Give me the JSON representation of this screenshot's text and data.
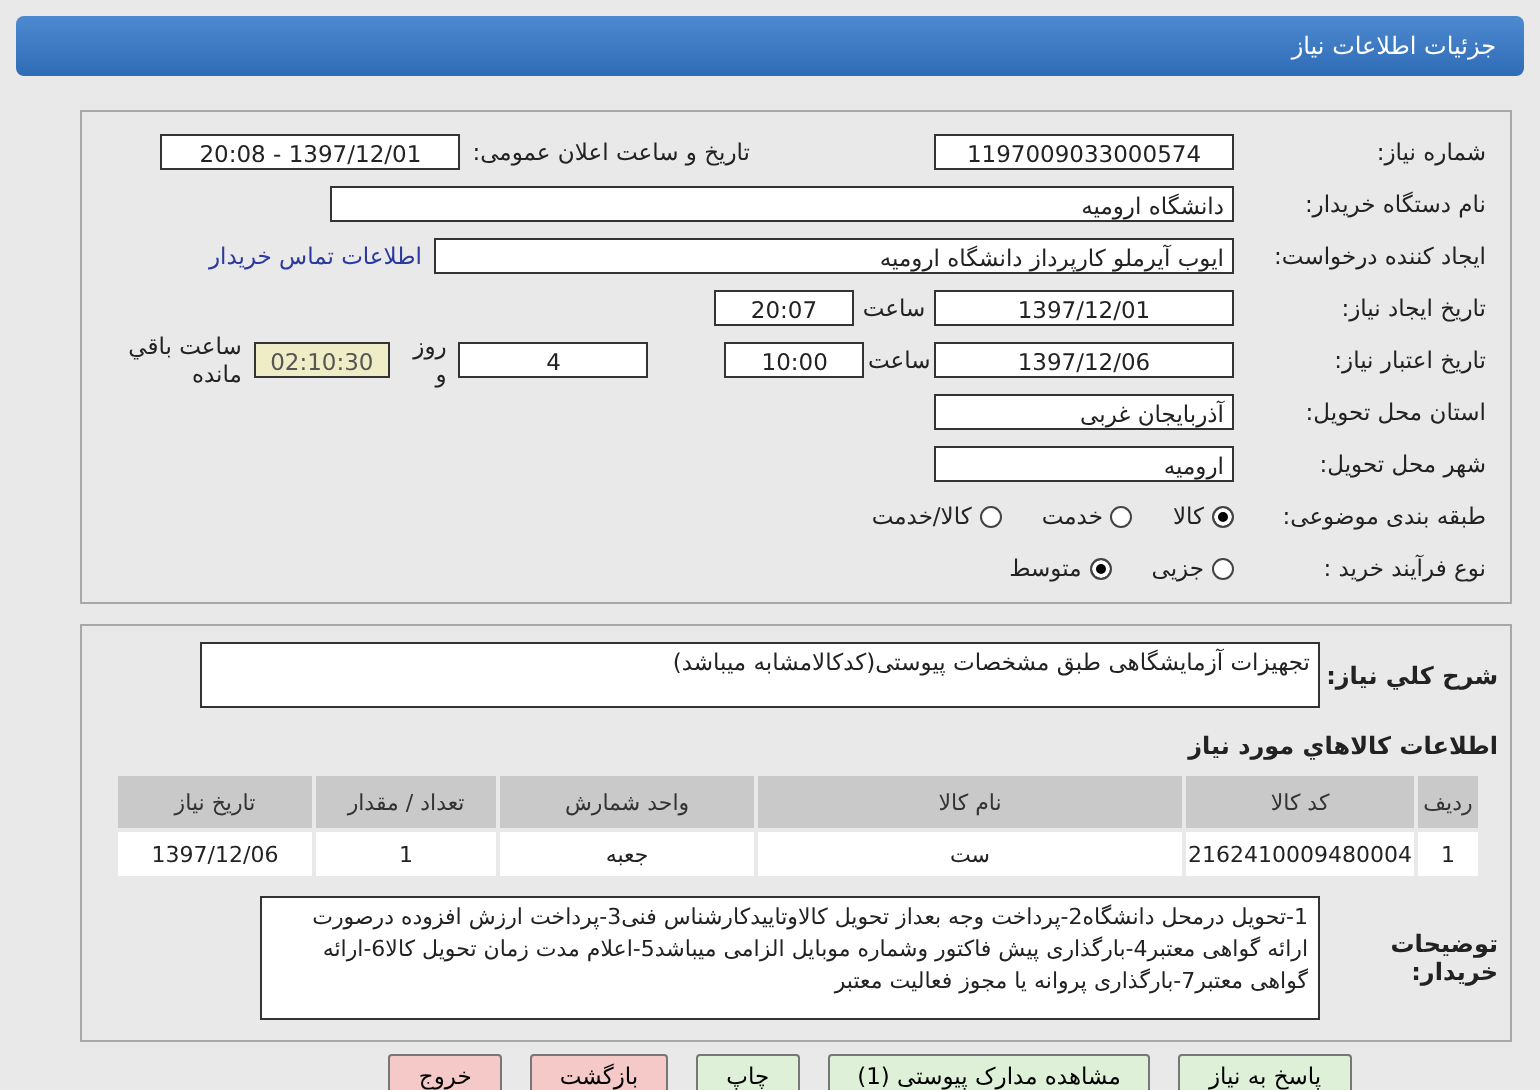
{
  "header": {
    "title": "جزئیات اطلاعات نیاز"
  },
  "form": {
    "need_number": {
      "label": "شماره نیاز:",
      "value": "1197009033000574"
    },
    "announce": {
      "label": "تاریخ و ساعت اعلان عمومی:",
      "value": "1397/12/01 - 20:08"
    },
    "buyer": {
      "label": "نام دستگاه خریدار:",
      "value": "دانشگاه ارومیه"
    },
    "creator": {
      "label": "ایجاد کننده درخواست:",
      "value": "ایوب آیرملو کارپرداز دانشگاه ارومیه",
      "link": "اطلاعات تماس خریدار"
    },
    "created": {
      "label": "تاریخ ایجاد نیاز:",
      "date": "1397/12/01",
      "time_label": "ساعت",
      "time": "20:07"
    },
    "valid": {
      "label": "تاریخ اعتبار نیاز:",
      "date": "1397/12/06",
      "time_label": "ساعت",
      "time": "10:00",
      "days": "4",
      "days_label": "روز و",
      "remaining": "02:10:30",
      "remaining_label": "ساعت باقي مانده"
    },
    "province": {
      "label": "استان محل تحویل:",
      "value": "آذربایجان غربی"
    },
    "city": {
      "label": "شهر محل تحویل:",
      "value": "ارومیه"
    },
    "category": {
      "label": "طبقه بندی موضوعی:",
      "options": [
        {
          "label": "کالا",
          "selected": true
        },
        {
          "label": "خدمت",
          "selected": false
        },
        {
          "label": "کالا/خدمت",
          "selected": false
        }
      ]
    },
    "process": {
      "label": "نوع فرآیند خرید :",
      "options": [
        {
          "label": "جزیی",
          "selected": false
        },
        {
          "label": "متوسط",
          "selected": true
        }
      ]
    }
  },
  "summary": {
    "label": "شرح کلي نياز:",
    "value": "تجهیزات آزمایشگاهی طبق مشخصات پیوستی(کدکالامشابه میباشد)"
  },
  "goods": {
    "title": "اطلاعات کالاهاي مورد نياز",
    "columns": [
      "ردیف",
      "کد کالا",
      "نام کالا",
      "واحد شمارش",
      "تعداد / مقدار",
      "تاریخ نیاز"
    ],
    "rows": [
      [
        "1",
        "2162410009480004",
        "ست",
        "جعبه",
        "1",
        "1397/12/06"
      ]
    ]
  },
  "notes": {
    "label": "توضیحات خریدار:",
    "value": "1-تحویل درمحل دانشگاه2-پرداخت وجه بعداز تحویل کالاوتاییدکارشناس فنی3-پرداخت ارزش افزوده درصورت ارائه گواهی معتبر4-بارگذاری پیش فاکتور وشماره موبایل الزامی میباشد5-اعلام مدت زمان تحویل کالا6-ارائه گواهی معتبر7-بارگذاری پروانه یا مجوز فعالیت معتبر"
  },
  "buttons": [
    {
      "label": "پاسخ به نیاز",
      "kind": "normal"
    },
    {
      "label": "مشاهده مدارک پیوستی (1)",
      "kind": "normal"
    },
    {
      "label": "چاپ",
      "kind": "normal"
    },
    {
      "label": "بازگشت",
      "kind": "danger"
    },
    {
      "label": "خروج",
      "kind": "danger"
    }
  ]
}
